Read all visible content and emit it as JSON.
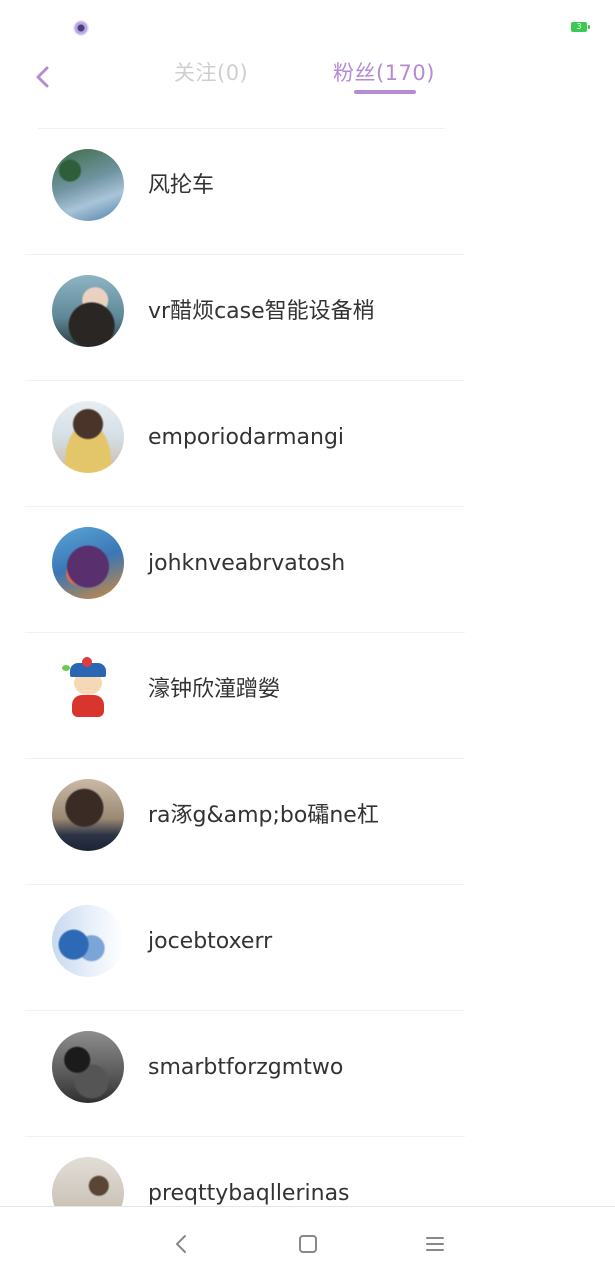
{
  "status_bar": {
    "battery_level": "3",
    "battery_color": "#3cc94f"
  },
  "header": {
    "back_icon": "chevron-left-icon",
    "tabs": [
      {
        "label": "关注(0)",
        "active": false
      },
      {
        "label": "粉丝(170)",
        "active": true
      }
    ],
    "accent_color": "#b58bd6"
  },
  "fans": [
    {
      "name": "风抡车"
    },
    {
      "name": "vr醋烦case智能设备梢"
    },
    {
      "name": "emporiodarmangi"
    },
    {
      "name": "johknveabrvatosh"
    },
    {
      "name": "濠钟欣潼蹭嫈"
    },
    {
      "name": "ra涿g&amp;bo礵ne杠"
    },
    {
      "name": "jocebtoxerr"
    },
    {
      "name": "smarbtforzgmtwo"
    },
    {
      "name": "preqttybaqllerinas"
    }
  ],
  "nav_bar": {
    "icons": [
      "nav-back-icon",
      "nav-home-icon",
      "nav-menu-icon"
    ]
  }
}
